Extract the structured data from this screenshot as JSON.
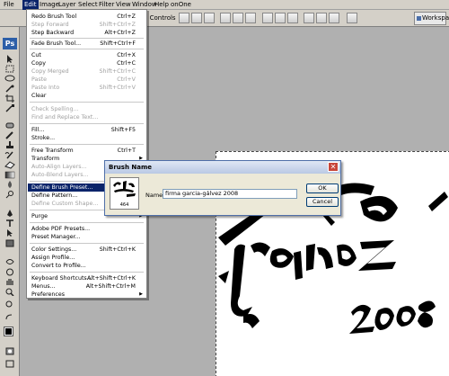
{
  "menubar": {
    "items": [
      "File",
      "Edit",
      "Image",
      "Layer",
      "Select",
      "Filter",
      "View",
      "Window",
      "Help",
      "onOne"
    ],
    "active": "Edit"
  },
  "options_bar": {
    "show_transform_label": "nsform Controls",
    "workspace_label": "Workspa"
  },
  "tools": {
    "logo": "Ps"
  },
  "edit_menu": {
    "items": [
      {
        "label": "Redo Brush Tool",
        "shortcut": "Ctrl+Z",
        "enabled": true
      },
      {
        "label": "Step Forward",
        "shortcut": "Shift+Ctrl+Z",
        "enabled": false
      },
      {
        "label": "Step Backward",
        "shortcut": "Alt+Ctrl+Z",
        "enabled": true
      },
      {
        "label": "Fade Brush Tool...",
        "shortcut": "Shift+Ctrl+F",
        "enabled": true
      },
      {
        "label": "Cut",
        "shortcut": "Ctrl+X",
        "enabled": true
      },
      {
        "label": "Copy",
        "shortcut": "Ctrl+C",
        "enabled": true
      },
      {
        "label": "Copy Merged",
        "shortcut": "Shift+Ctrl+C",
        "enabled": false
      },
      {
        "label": "Paste",
        "shortcut": "Ctrl+V",
        "enabled": false
      },
      {
        "label": "Paste Into",
        "shortcut": "Shift+Ctrl+V",
        "enabled": false
      },
      {
        "label": "Clear",
        "shortcut": "",
        "enabled": true
      },
      {
        "label": "Check Spelling...",
        "shortcut": "",
        "enabled": false
      },
      {
        "label": "Find and Replace Text...",
        "shortcut": "",
        "enabled": false
      },
      {
        "label": "Fill...",
        "shortcut": "Shift+F5",
        "enabled": true
      },
      {
        "label": "Stroke...",
        "shortcut": "",
        "enabled": true
      },
      {
        "label": "Free Transform",
        "shortcut": "Ctrl+T",
        "enabled": true
      },
      {
        "label": "Transform",
        "shortcut": "",
        "enabled": true,
        "submenu": true
      },
      {
        "label": "Auto-Align Layers...",
        "shortcut": "",
        "enabled": false
      },
      {
        "label": "Auto-Blend Layers...",
        "shortcut": "",
        "enabled": false
      },
      {
        "label": "Define Brush Preset...",
        "shortcut": "",
        "enabled": true,
        "highlighted": true
      },
      {
        "label": "Define Pattern...",
        "shortcut": "",
        "enabled": true
      },
      {
        "label": "Define Custom Shape...",
        "shortcut": "",
        "enabled": false
      },
      {
        "label": "Purge",
        "shortcut": "",
        "enabled": true,
        "submenu": true
      },
      {
        "label": "Adobe PDF Presets...",
        "shortcut": "",
        "enabled": true
      },
      {
        "label": "Preset Manager...",
        "shortcut": "",
        "enabled": true
      },
      {
        "label": "Color Settings...",
        "shortcut": "Shift+Ctrl+K",
        "enabled": true
      },
      {
        "label": "Assign Profile...",
        "shortcut": "",
        "enabled": true
      },
      {
        "label": "Convert to Profile...",
        "shortcut": "",
        "enabled": true
      },
      {
        "label": "Keyboard Shortcuts...",
        "shortcut": "Alt+Shift+Ctrl+K",
        "enabled": true
      },
      {
        "label": "Menus...",
        "shortcut": "Alt+Shift+Ctrl+M",
        "enabled": true
      },
      {
        "label": "Preferences",
        "shortcut": "",
        "enabled": true,
        "submenu": true
      }
    ]
  },
  "dialog": {
    "title": "Brush Name",
    "close_glyph": "✕",
    "preview_size": "464",
    "name_label": "Name:",
    "name_value": "firma garcia-gálvez 2008",
    "ok_label": "OK",
    "cancel_label": "Cancel"
  },
  "document": {
    "artwork_text": [
      "gálvez",
      "2008"
    ]
  }
}
